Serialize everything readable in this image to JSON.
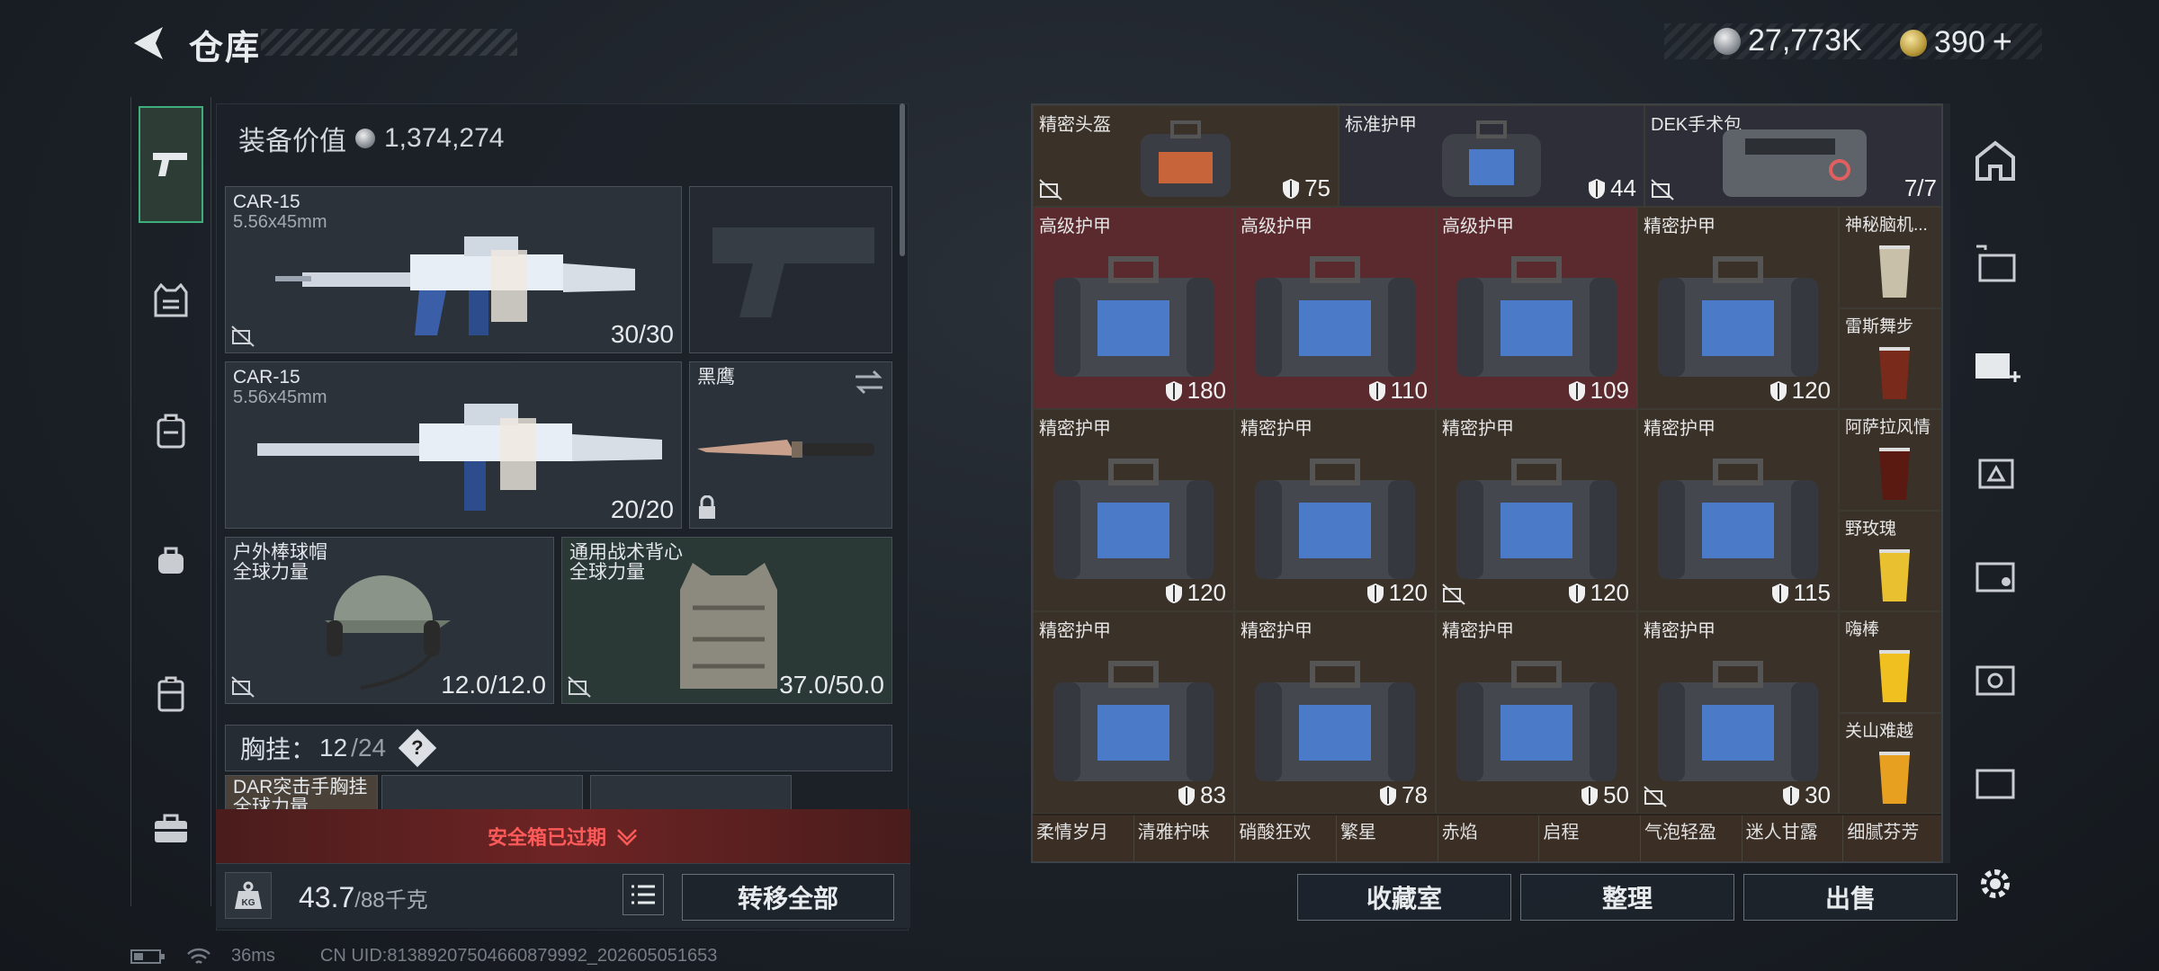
{
  "header": {
    "title": "仓库",
    "silver": "27,773K",
    "gold": "390",
    "gold_plus": "+"
  },
  "equip": {
    "label": "装备价值",
    "value": "1,374,274"
  },
  "weapons": [
    {
      "name": "CAR-15",
      "ammo": "5.56x45mm",
      "count": "30/30"
    },
    {
      "name": "CAR-15",
      "ammo": "5.56x45mm",
      "count": "20/20"
    }
  ],
  "knife": {
    "name": "黑鹰"
  },
  "helmet": {
    "name": "户外棒球帽",
    "brand": "全球力量",
    "durability": "12.0/12.0"
  },
  "vest": {
    "name": "通用战术背心",
    "brand": "全球力量",
    "durability": "37.0/50.0"
  },
  "chest_rig": {
    "label": "胸挂：",
    "current": "12",
    "capacity": "/24",
    "help": "?",
    "item_name": "DAR突击手胸挂",
    "item_brand": "全球力量"
  },
  "safe_box": {
    "status": "安全箱已过期"
  },
  "weight": {
    "current": "43.7",
    "capacity": "/88千克",
    "icon_label": "KG"
  },
  "buttons": {
    "transfer_all": "转移全部",
    "collection": "收藏室",
    "organize": "整理",
    "sell": "出售"
  },
  "status_bar": {
    "ping": "36ms",
    "uid": "CN UID:813892075046608799​92_202605051653"
  },
  "grid_top": [
    {
      "name": "精密头盔",
      "value": "75"
    },
    {
      "name": "标准护甲",
      "value": "44"
    },
    {
      "name": "DEK手术包",
      "value": "7/7"
    }
  ],
  "grid_rows": [
    [
      {
        "name": "高级护甲",
        "value": "180"
      },
      {
        "name": "高级护甲",
        "value": "110"
      },
      {
        "name": "高级护甲",
        "value": "109"
      },
      {
        "name": "精密护甲",
        "value": "120"
      }
    ],
    [
      {
        "name": "精密护甲",
        "value": "120"
      },
      {
        "name": "精密护甲",
        "value": "120"
      },
      {
        "name": "精密护甲",
        "value": "120"
      },
      {
        "name": "精密护甲",
        "value": "115"
      }
    ],
    [
      {
        "name": "精密护甲",
        "value": "83"
      },
      {
        "name": "精密护甲",
        "value": "78"
      },
      {
        "name": "精密护甲",
        "value": "50"
      },
      {
        "name": "精密护甲",
        "value": "30"
      }
    ]
  ],
  "side_items": [
    "神秘脑机...",
    "雷斯舞步",
    "阿萨拉风情",
    "野玫瑰",
    "嗨棒",
    "关山难越"
  ],
  "bottom_strip": [
    "柔情岁月",
    "清雅柠味",
    "硝酸狂欢",
    "繁星",
    "赤焰",
    "启程",
    "气泡轻盈",
    "迷人甘露",
    "细腻芬芳"
  ]
}
